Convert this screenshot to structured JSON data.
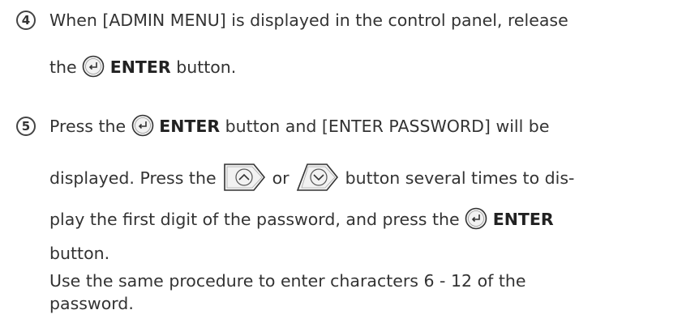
{
  "steps": [
    {
      "number": "4",
      "lines": {
        "l1": "When [ADMIN MENU] is displayed in the control panel, release",
        "l2_pre": "the",
        "l2_bold": "ENTER",
        "l2_post": "button."
      }
    },
    {
      "number": "5",
      "lines": {
        "l1_pre": "Press the",
        "l1_bold": "ENTER",
        "l1_post": "button and [ENTER PASSWORD] will be",
        "l2_pre": "displayed.  Press the",
        "l2_mid": "or",
        "l2_post": "button several times to dis-",
        "l3_pre": "play the first digit of the password, and press the",
        "l3_bold": "ENTER",
        "l4": "button.",
        "l5": "Use the same procedure to enter characters 6 - 12 of the",
        "l6": "password."
      }
    }
  ],
  "icons": {
    "enter": "enter-button-icon",
    "up": "up-arrow-button-icon",
    "down": "down-arrow-button-icon"
  }
}
